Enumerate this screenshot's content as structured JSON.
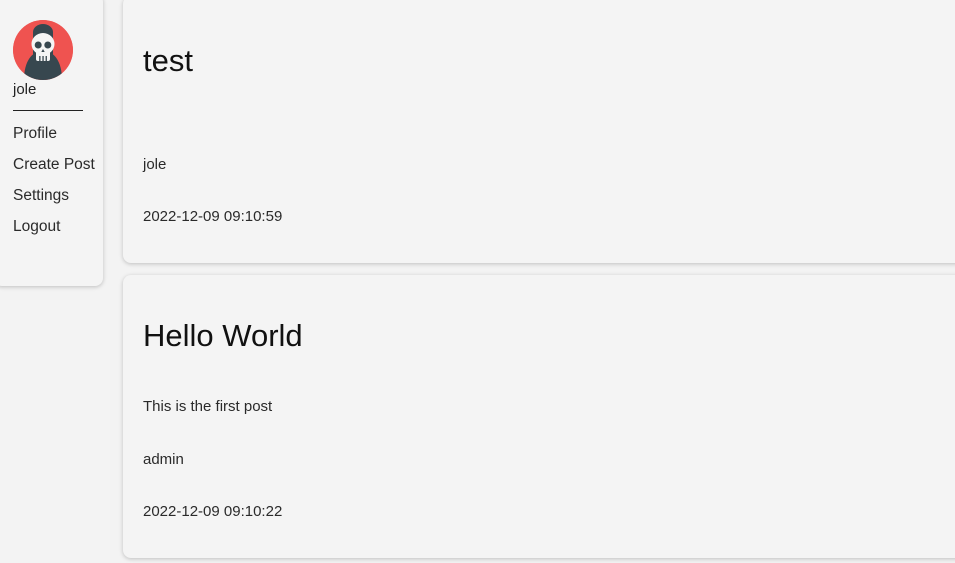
{
  "user": {
    "name": "jole",
    "avatar_icon": "skull-icon",
    "avatar_bg": "#ef5350"
  },
  "nav": {
    "profile": "Profile",
    "create_post": "Create Post",
    "settings": "Settings",
    "logout": "Logout"
  },
  "posts": [
    {
      "title": "test",
      "body": "",
      "author": "jole",
      "date": "2022-12-09 09:10:59"
    },
    {
      "title": "Hello World",
      "body": "This is the first post",
      "author": "admin",
      "date": "2022-12-09 09:10:22"
    }
  ]
}
